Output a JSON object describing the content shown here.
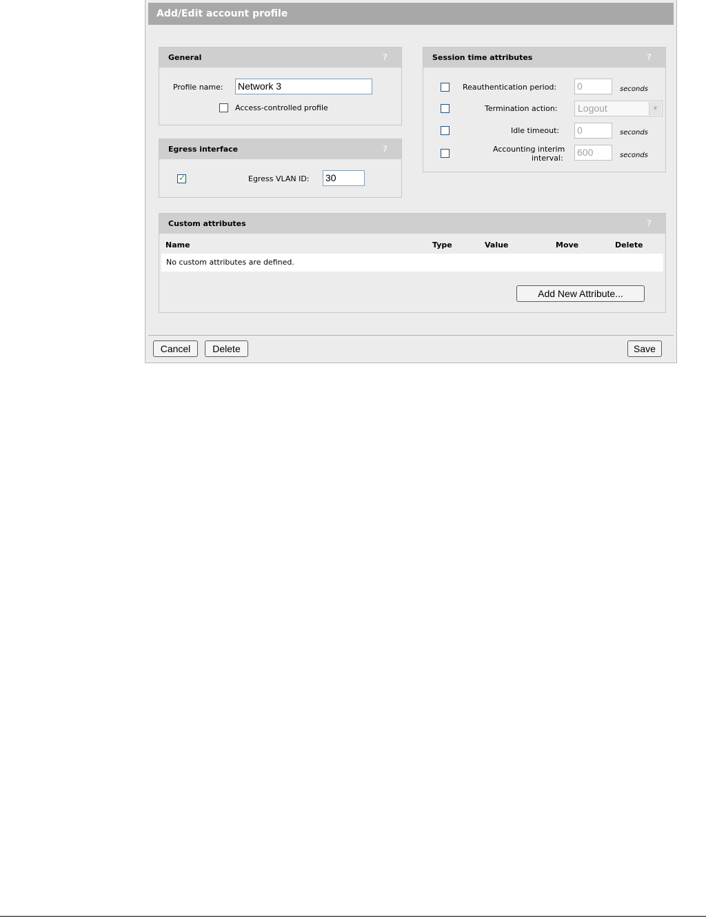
{
  "dialog": {
    "title": "Add/Edit account profile"
  },
  "help_symbol": "?",
  "general": {
    "title": "General",
    "profile_name_label": "Profile name:",
    "profile_name_value": "Network 3",
    "access_controlled_label": "Access-controlled profile",
    "access_controlled_checked": false
  },
  "egress": {
    "title": "Egress interface",
    "vlan_checked": true,
    "vlan_label": "Egress VLAN ID:",
    "vlan_value": "30"
  },
  "session": {
    "title": "Session time attributes",
    "reauth_label": "Reauthentication period:",
    "reauth_value": "0",
    "reauth_unit": "seconds",
    "termination_label": "Termination action:",
    "termination_value": "Logout",
    "idle_label": "Idle timeout:",
    "idle_value": "0",
    "idle_unit": "seconds",
    "accounting_label_line1": "Accounting interim",
    "accounting_label_line2": "interval:",
    "accounting_value": "600",
    "accounting_unit": "seconds"
  },
  "custom": {
    "title": "Custom attributes",
    "columns": [
      "Name",
      "Type",
      "Value",
      "Move",
      "Delete"
    ],
    "empty_message": "No custom attributes are defined.",
    "add_button": "Add New Attribute..."
  },
  "footer": {
    "cancel": "Cancel",
    "delete": "Delete",
    "save": "Save"
  }
}
